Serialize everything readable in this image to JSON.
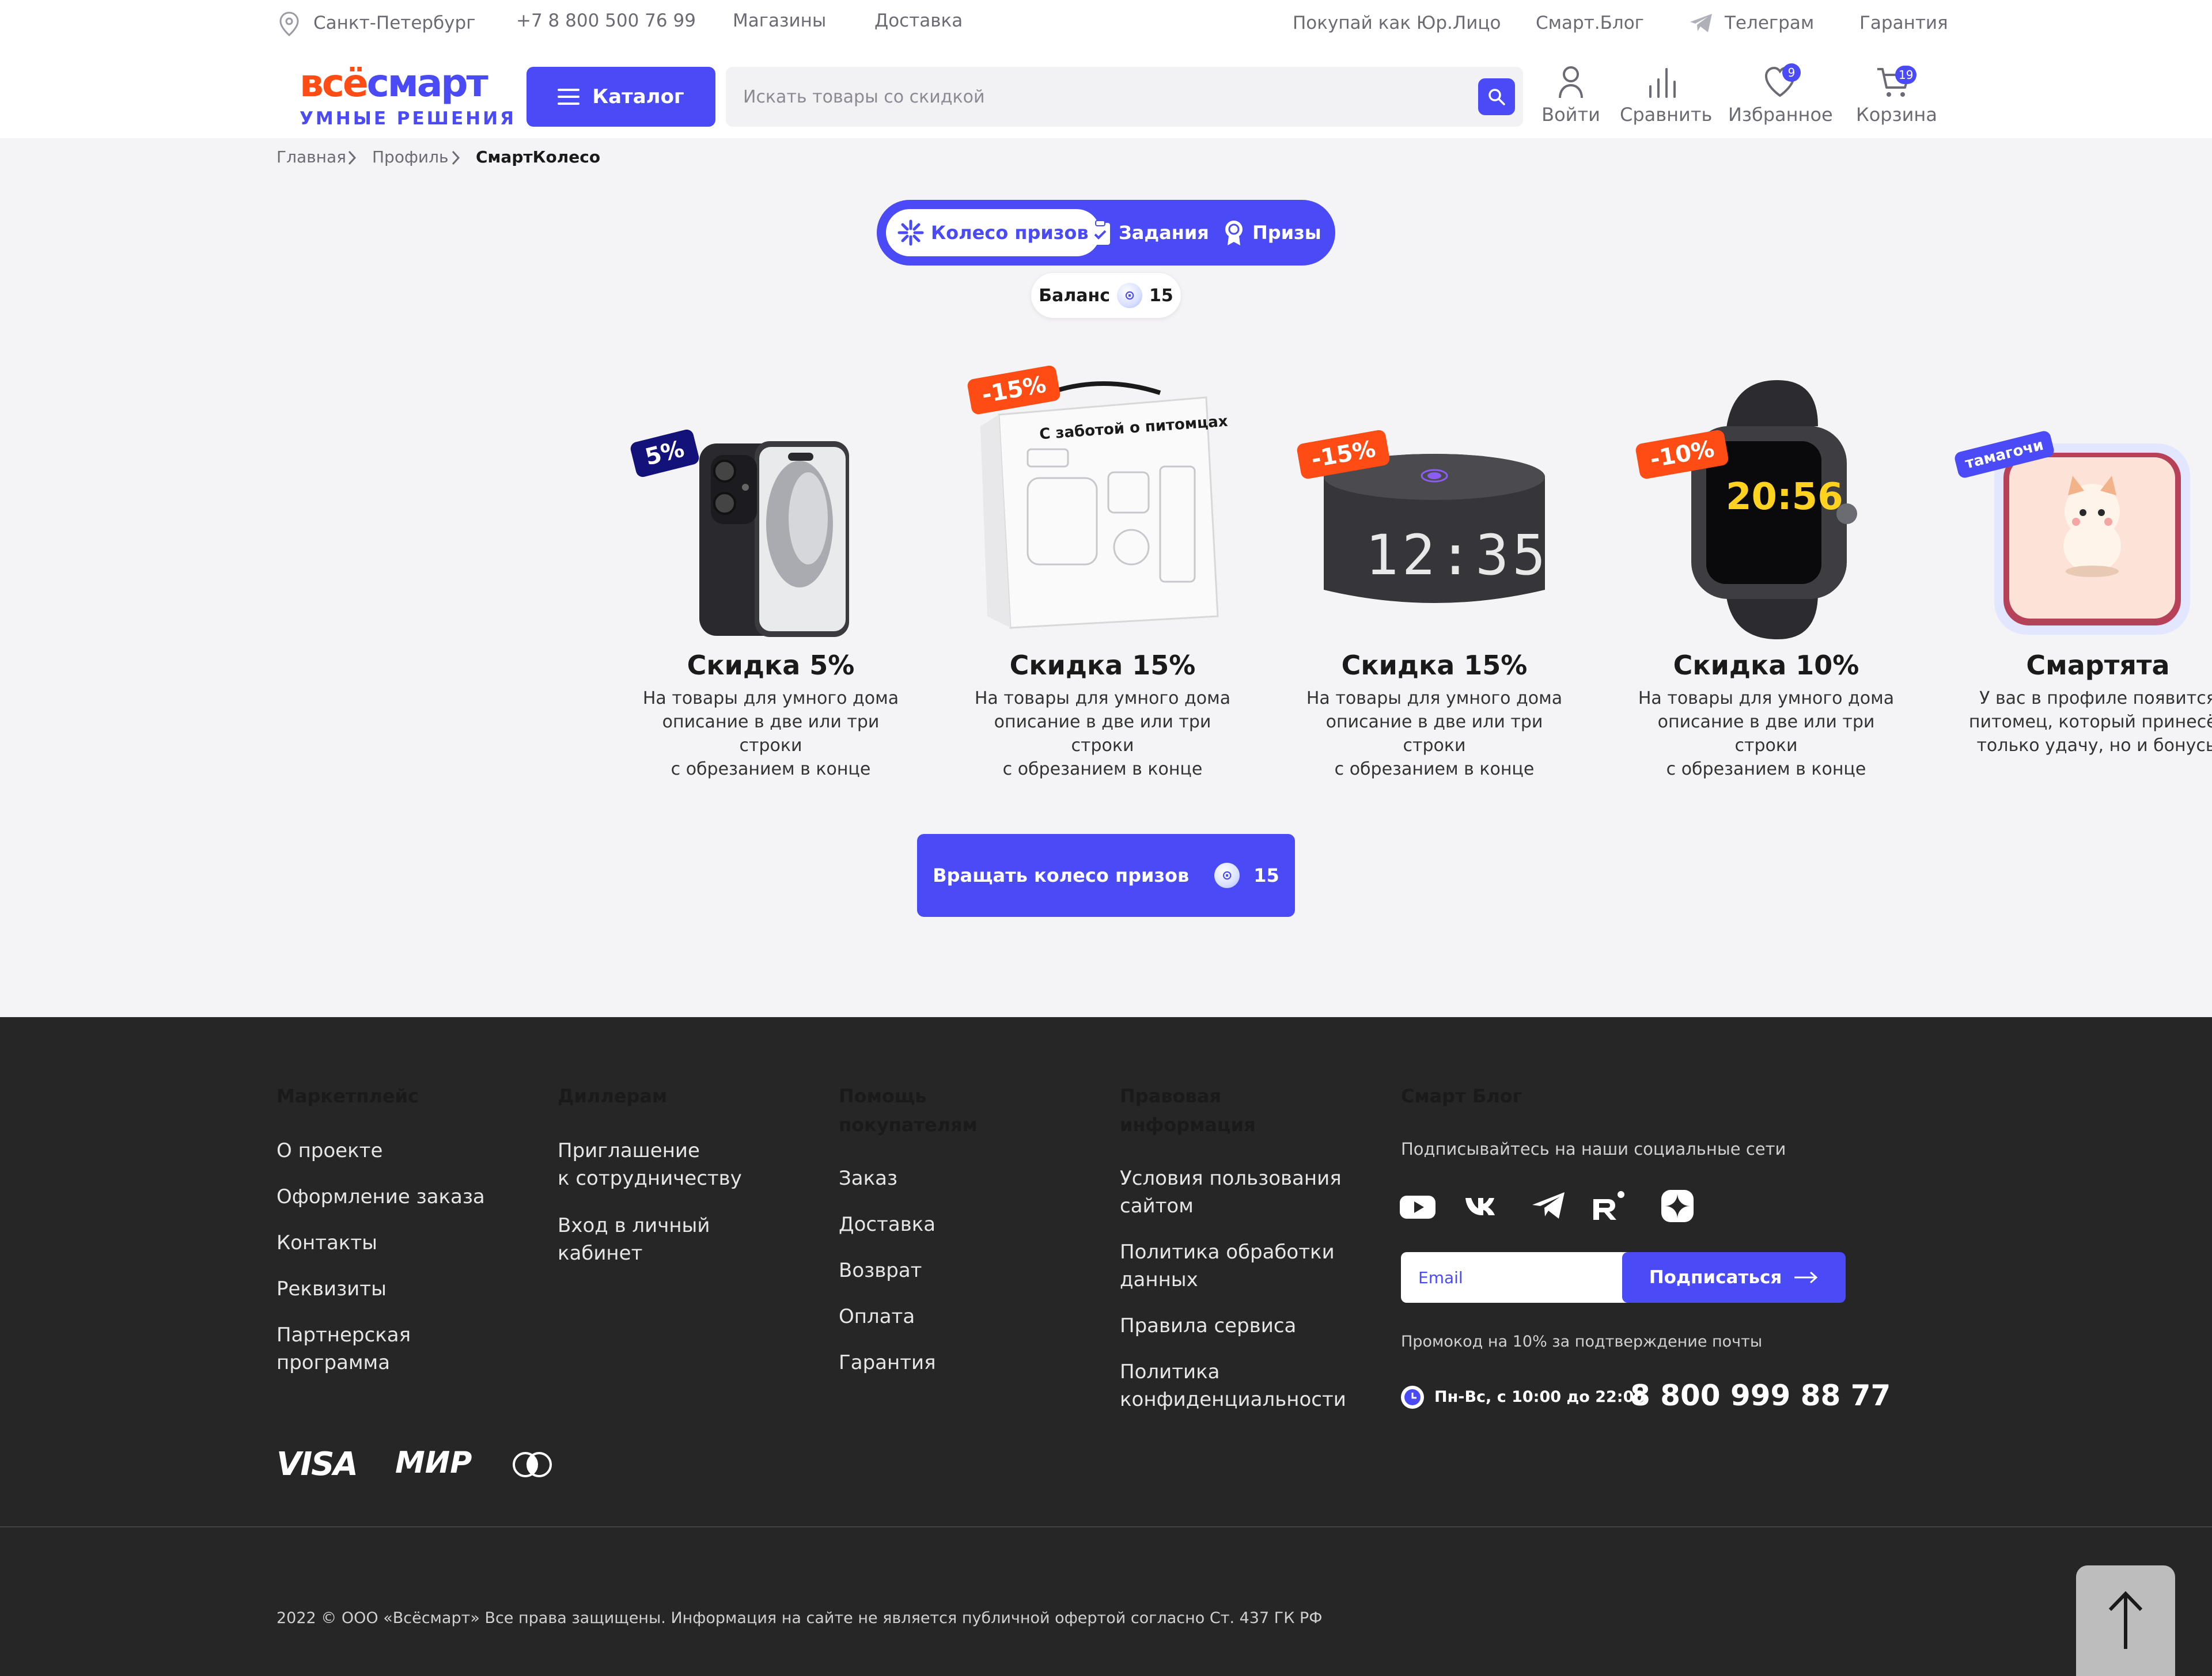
{
  "topbar": {
    "city": "Санкт-Петербург",
    "phone": "+7 8 800 500 76 99",
    "stores": "Магазины",
    "delivery": "Доставка",
    "legal": "Покупай как Юр.Лицо",
    "blog": "Смарт.Блог",
    "telegram": "Телеграм",
    "warranty": "Гарантия"
  },
  "header": {
    "logo_top": "всёсмарт",
    "logo_bottom": "УМНЫЕ РЕШЕНИЯ",
    "catalog": "Каталог",
    "search_placeholder": "Искать товары со скидкой",
    "login": "Войти",
    "compare": "Сравнить",
    "favorites": "Избранное",
    "favorites_count": "9",
    "cart": "Корзина",
    "cart_count": "19"
  },
  "breadcrumb": [
    "Главная",
    "Профиль",
    "СмартКолесо"
  ],
  "tabs": [
    "Колесо призов",
    "Задания",
    "Призы"
  ],
  "balance": {
    "label": "Баланс",
    "value": "15"
  },
  "prizes": [
    {
      "tag": "5%",
      "title": "Скидка 5%",
      "desc": "На товары для умного дома\nописание в две или три строки\nс обрезанием в конце",
      "image": "smartphone",
      "tag_color": "#12127a"
    },
    {
      "tag": "-15%",
      "title": "Скидка 15%",
      "desc": "На товары для умного дома\nописание в две или три строки\nс обрезанием в конце",
      "image": "pet-care-kit",
      "box_label": "С заботой о питомцах",
      "tag_color": "#ff4b14"
    },
    {
      "tag": "-15%",
      "title": "Скидка 15%",
      "desc": "На товары для умного дома\nописание в две или три строки\nс обрезанием в конце",
      "image": "smart-speaker",
      "clock": "12:35",
      "tag_color": "#ff4b14"
    },
    {
      "tag": "-10%",
      "title": "Скидка 10%",
      "desc": "На товары для умного дома\nописание в две или три строки\nс обрезанием в конце",
      "image": "smart-watch",
      "clock": "20:56",
      "tag_color": "#ff4b14"
    },
    {
      "tag": "тамагочи",
      "title": "Смартята",
      "desc": "У вас в профиле появится\nпитомец, который принесёт\nтолько удачу, но и бонусы",
      "image": "tamagotchi-cat",
      "tag_color": "#4a4af7"
    }
  ],
  "spin_button": {
    "label": "Вращать колесо призов",
    "cost": "15"
  },
  "footer": {
    "columns": [
      {
        "title": "Маркетплейс",
        "links": [
          "О проекте",
          "Оформление заказа",
          "Контакты",
          "Реквизиты",
          "Партнерская\nпрограмма"
        ]
      },
      {
        "title": "Диллерам",
        "links": [
          "Приглашение\nк сотрудничеству",
          "Вход в личный\nкабинет"
        ]
      },
      {
        "title": "Помощь\nпокупателям",
        "links": [
          "Заказ",
          "Доставка",
          "Возврат",
          "Оплата",
          "Гарантия"
        ]
      },
      {
        "title": "Правовая\nинформация",
        "links": [
          "Условия пользования\nсайтом",
          "Политика обработки\nданных",
          "Правила сервиса",
          "Политика\nконфиденциальности"
        ]
      }
    ],
    "blog_title": "Смарт Блог",
    "social_text": "Подписывайтесь на наши социальные сети",
    "socials": [
      "youtube-icon",
      "vk-icon",
      "telegram-icon",
      "rutube-icon",
      "dzen-icon"
    ],
    "email_placeholder": "Email",
    "subscribe": "Подписаться",
    "promo": "Промокод на 10% за подтверждение почты",
    "hours": "Пн-Вс, с 10:00 до 22:00",
    "phone": "8 800 999 88 77",
    "payments": [
      "VISA",
      "МИР",
      "mastercard-icon"
    ],
    "copyright": "2022 © ООО «Всёсмарт» Все права защищены. Информация на сайте не является публичной офертой согласно Ст. 437 ГК РФ"
  },
  "colors": {
    "accent": "#4a4af7",
    "sale": "#ff4b14",
    "footer_bg": "#262626",
    "logo_orange": "#ff4b14"
  }
}
